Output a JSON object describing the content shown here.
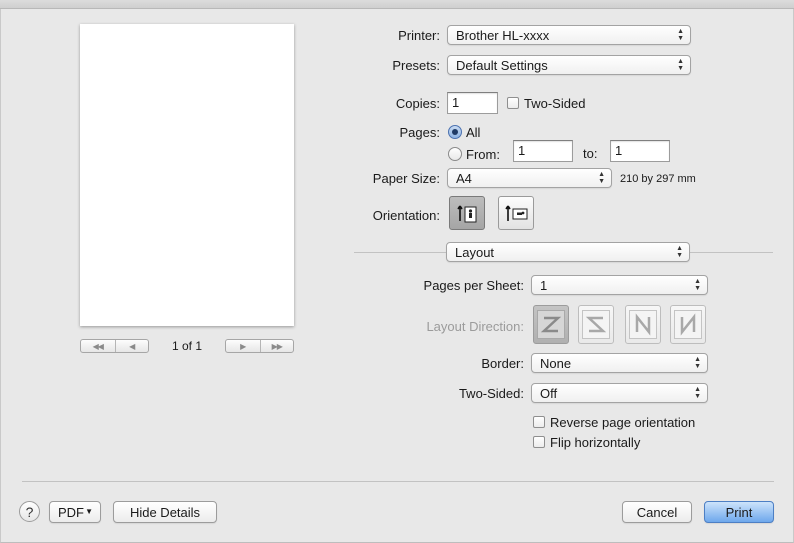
{
  "printer": {
    "label": "Printer:",
    "value": "Brother HL-xxxx"
  },
  "presets": {
    "label": "Presets:",
    "value": "Default Settings"
  },
  "copies": {
    "label": "Copies:",
    "value": "1",
    "two_sided_label": "Two-Sided",
    "two_sided_checked": false
  },
  "pages": {
    "label": "Pages:",
    "all_label": "All",
    "from_label": "From:",
    "from_value": "1",
    "to_label": "to:",
    "to_value": "1",
    "selected": "all"
  },
  "paper_size": {
    "label": "Paper Size:",
    "value": "A4",
    "dimensions": "210 by 297 mm"
  },
  "orientation": {
    "label": "Orientation:",
    "options": [
      "portrait-icon",
      "landscape-icon"
    ],
    "selected": "portrait"
  },
  "section": {
    "value": "Layout"
  },
  "layout": {
    "pages_per_sheet_label": "Pages per Sheet:",
    "pages_per_sheet_value": "1",
    "direction_label": "Layout Direction:",
    "direction_icons": [
      "layout-z-icon",
      "layout-reverse-z-icon",
      "layout-n-icon",
      "layout-reverse-n-icon"
    ],
    "border_label": "Border:",
    "border_value": "None",
    "two_sided_label": "Two-Sided:",
    "two_sided_value": "Off",
    "reverse_label": "Reverse page orientation",
    "reverse_checked": false,
    "flip_label": "Flip horizontally",
    "flip_checked": false
  },
  "preview": {
    "page_count": "1 of 1"
  },
  "footer": {
    "help": "?",
    "pdf_label": "PDF",
    "hide_details_label": "Hide Details",
    "cancel_label": "Cancel",
    "print_label": "Print"
  },
  "colors": {
    "accent": "#6ea7ec",
    "radio_selected": "#1f3a66"
  }
}
